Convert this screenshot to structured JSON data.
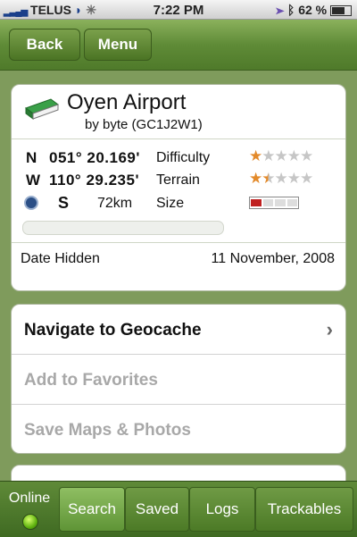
{
  "status_bar": {
    "carrier": "TELUS",
    "time": "7:22 PM",
    "battery": "62 %",
    "icons": [
      "signal-bars-icon",
      "wifi-icon",
      "activity-spinner-icon",
      "location-arrow-icon",
      "bluetooth-icon",
      "battery-icon"
    ]
  },
  "nav": {
    "back_label": "Back",
    "menu_label": "Menu"
  },
  "cache": {
    "name": "Oyen Airport",
    "owner_line": "by byte (GC1J2W1)",
    "lat_dir": "N",
    "lat_value": "051° 20.169'",
    "lon_dir": "W",
    "lon_value": "110° 29.235'",
    "difficulty_label": "Difficulty",
    "difficulty_rating": 1,
    "terrain_label": "Terrain",
    "terrain_rating": 1.5,
    "direction": "S",
    "distance": "72km",
    "size_label": "Size",
    "size_level": 1,
    "date_hidden_label": "Date Hidden",
    "date_hidden": "11 November, 2008"
  },
  "actions": [
    {
      "label": "Navigate to Geocache",
      "enabled": true
    },
    {
      "label": "Add to Favorites",
      "enabled": false
    },
    {
      "label": "Save Maps & Photos",
      "enabled": false
    }
  ],
  "tabbar": {
    "online_label": "Online",
    "tabs": [
      {
        "label": "Search",
        "active": true
      },
      {
        "label": "Saved",
        "active": false
      },
      {
        "label": "Logs",
        "active": false
      },
      {
        "label": "Trackables",
        "active": false
      }
    ]
  },
  "colors": {
    "accent_green": "#5f8b37",
    "star_on": "#e38a2b",
    "size_fill": "#c02020"
  }
}
